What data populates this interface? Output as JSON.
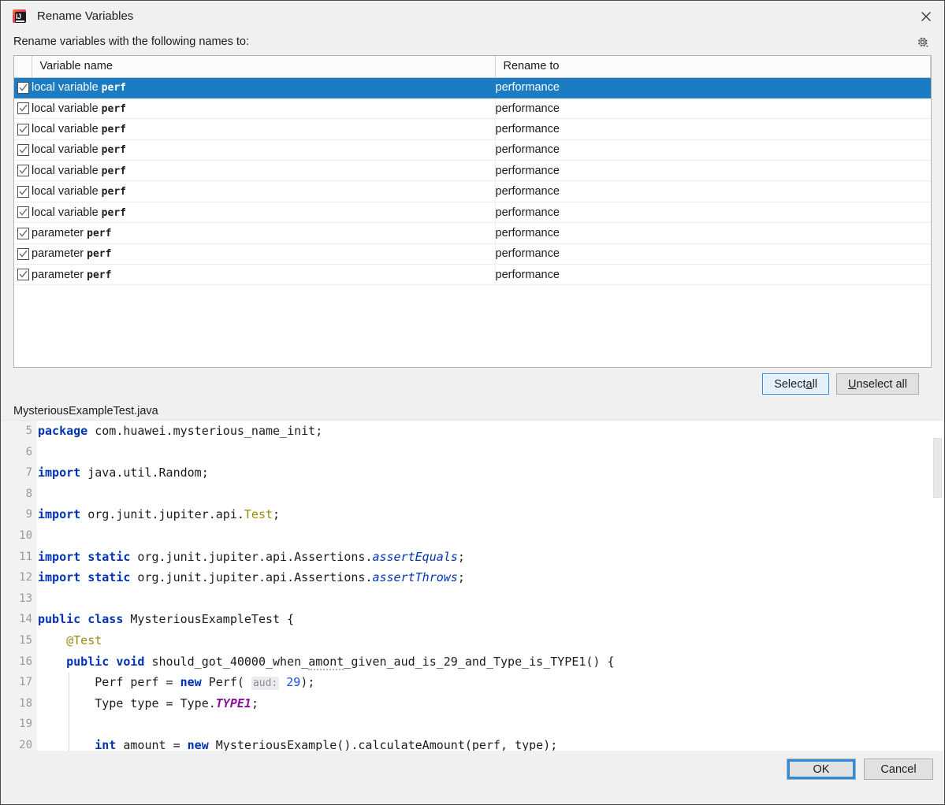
{
  "window": {
    "title": "Rename Variables",
    "app_icon": "intellij-idea-icon",
    "close_icon": "close-icon"
  },
  "top": {
    "prompt": "Rename variables with the following names to:",
    "settings_icon": "gear-icon"
  },
  "table": {
    "columns": [
      "",
      "Variable name",
      "Rename to"
    ],
    "rows": [
      {
        "checked": true,
        "selected": true,
        "kind": "local variable",
        "name": "perf",
        "rename_to": "performance"
      },
      {
        "checked": true,
        "selected": false,
        "kind": "local variable",
        "name": "perf",
        "rename_to": "performance"
      },
      {
        "checked": true,
        "selected": false,
        "kind": "local variable",
        "name": "perf",
        "rename_to": "performance"
      },
      {
        "checked": true,
        "selected": false,
        "kind": "local variable",
        "name": "perf",
        "rename_to": "performance"
      },
      {
        "checked": true,
        "selected": false,
        "kind": "local variable",
        "name": "perf",
        "rename_to": "performance"
      },
      {
        "checked": true,
        "selected": false,
        "kind": "local variable",
        "name": "perf",
        "rename_to": "performance"
      },
      {
        "checked": true,
        "selected": false,
        "kind": "local variable",
        "name": "perf",
        "rename_to": "performance"
      },
      {
        "checked": true,
        "selected": false,
        "kind": "parameter",
        "name": "perf",
        "rename_to": "performance"
      },
      {
        "checked": true,
        "selected": false,
        "kind": "parameter",
        "name": "perf",
        "rename_to": "performance"
      },
      {
        "checked": true,
        "selected": false,
        "kind": "parameter",
        "name": "perf",
        "rename_to": "performance"
      }
    ]
  },
  "selection_buttons": {
    "select_all": "Select all",
    "select_all_mnemonic": "a",
    "unselect_all": "Unselect all",
    "unselect_all_mnemonic": "U"
  },
  "preview": {
    "file_name": "MysteriousExampleTest.java",
    "first_line_number": 5,
    "lines": [
      {
        "n": 5,
        "tokens": [
          {
            "t": "package",
            "c": "kw"
          },
          {
            "t": " com.huawei.mysterious_name_init;",
            "c": ""
          }
        ]
      },
      {
        "n": 6,
        "tokens": []
      },
      {
        "n": 7,
        "tokens": [
          {
            "t": "import",
            "c": "kw"
          },
          {
            "t": " java.util.Random;",
            "c": ""
          }
        ]
      },
      {
        "n": 8,
        "tokens": []
      },
      {
        "n": 9,
        "tokens": [
          {
            "t": "import",
            "c": "kw"
          },
          {
            "t": " org.junit.jupiter.api.",
            "c": ""
          },
          {
            "t": "Test",
            "c": "anno"
          },
          {
            "t": ";",
            "c": ""
          }
        ]
      },
      {
        "n": 10,
        "tokens": []
      },
      {
        "n": 11,
        "tokens": [
          {
            "t": "import static",
            "c": "kw"
          },
          {
            "t": " org.junit.jupiter.api.Assertions.",
            "c": ""
          },
          {
            "t": "assertEquals",
            "c": "stat"
          },
          {
            "t": ";",
            "c": ""
          }
        ]
      },
      {
        "n": 12,
        "tokens": [
          {
            "t": "import static",
            "c": "kw"
          },
          {
            "t": " org.junit.jupiter.api.Assertions.",
            "c": ""
          },
          {
            "t": "assertThrows",
            "c": "stat"
          },
          {
            "t": ";",
            "c": ""
          }
        ]
      },
      {
        "n": 13,
        "tokens": []
      },
      {
        "n": 14,
        "tokens": [
          {
            "t": "public class",
            "c": "kw"
          },
          {
            "t": " MysteriousExampleTest {",
            "c": ""
          }
        ]
      },
      {
        "n": 15,
        "tokens": [
          {
            "t": "    ",
            "c": ""
          },
          {
            "t": "@Test",
            "c": "anno"
          }
        ]
      },
      {
        "n": 16,
        "tokens": [
          {
            "t": "    ",
            "c": ""
          },
          {
            "t": "public void",
            "c": "kw"
          },
          {
            "t": " should_got_40000_when_",
            "c": ""
          },
          {
            "t": "amont",
            "c": "typo"
          },
          {
            "t": "_given_aud_is_29_and_Type_is_TYPE1() {",
            "c": ""
          }
        ]
      },
      {
        "n": 17,
        "tokens": [
          {
            "t": "        Perf perf = ",
            "c": ""
          },
          {
            "t": "new",
            "c": "kw"
          },
          {
            "t": " Perf( ",
            "c": ""
          },
          {
            "t": "aud:",
            "c": "hint"
          },
          {
            "t": " ",
            "c": ""
          },
          {
            "t": "29",
            "c": "num"
          },
          {
            "t": ");",
            "c": ""
          }
        ]
      },
      {
        "n": 18,
        "tokens": [
          {
            "t": "        Type type = Type.",
            "c": ""
          },
          {
            "t": "TYPE1",
            "c": "const"
          },
          {
            "t": ";",
            "c": ""
          }
        ]
      },
      {
        "n": 19,
        "tokens": []
      },
      {
        "n": 20,
        "tokens": [
          {
            "t": "        ",
            "c": ""
          },
          {
            "t": "int",
            "c": "kw"
          },
          {
            "t": " amount = ",
            "c": ""
          },
          {
            "t": "new",
            "c": "kw"
          },
          {
            "t": " MysteriousExample().calculateAmount(perf, type);",
            "c": ""
          }
        ]
      }
    ]
  },
  "footer": {
    "ok": "OK",
    "cancel": "Cancel"
  },
  "colors": {
    "selection_blue": "#1b7cc4",
    "focus_blue": "#2d8ce0",
    "keyword": "#0033b3",
    "annotation": "#9e880d",
    "number": "#1750eb",
    "constant": "#871094",
    "dialog_bg": "#f0f0f0"
  }
}
